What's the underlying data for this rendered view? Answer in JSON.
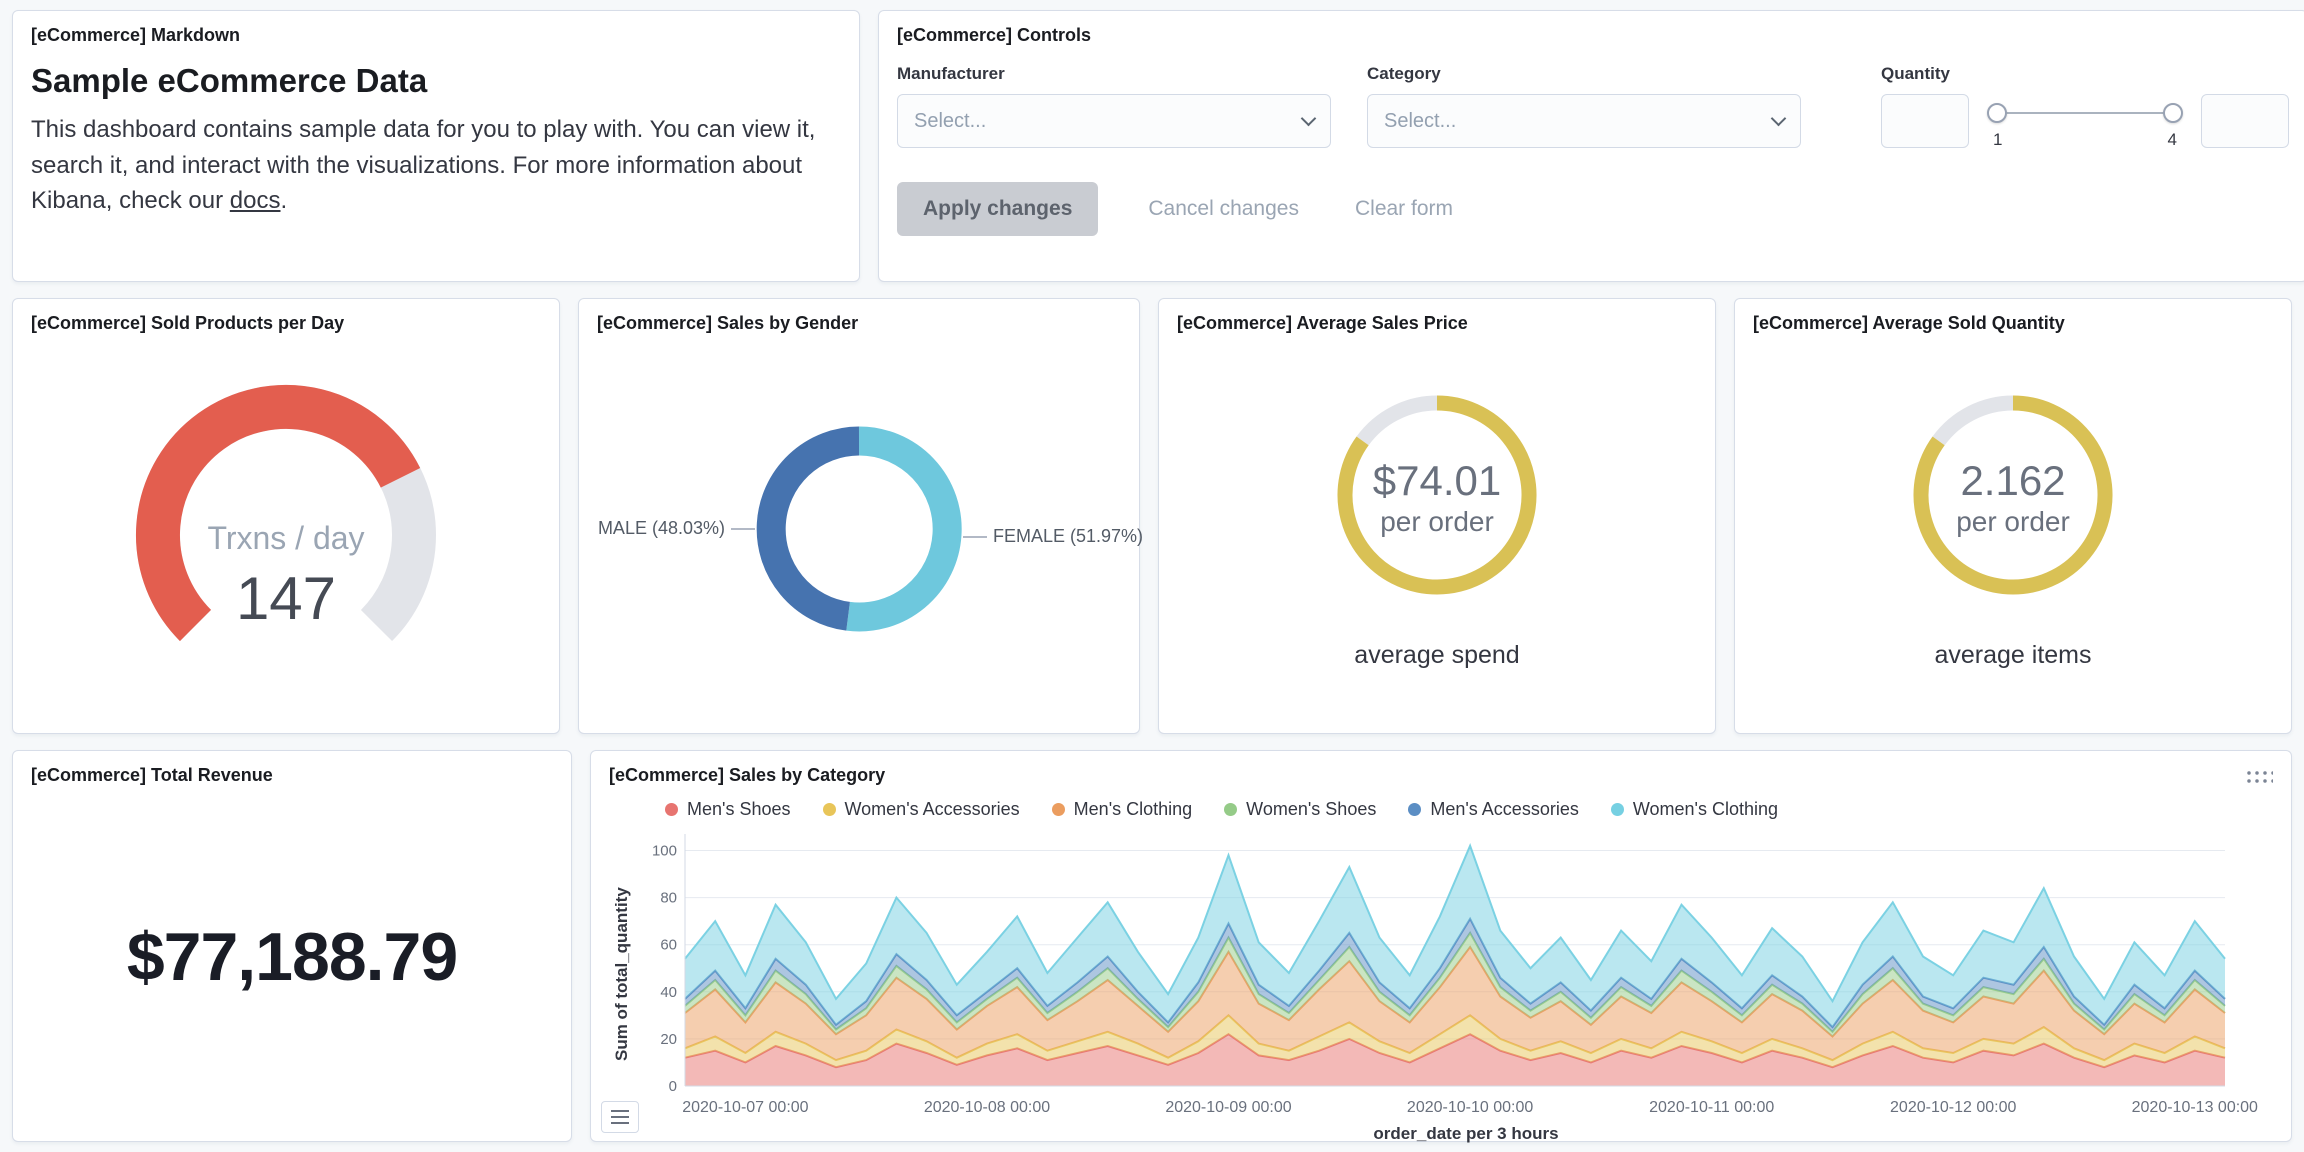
{
  "markdown_panel": {
    "title": "[eCommerce] Markdown",
    "heading": "Sample eCommerce Data",
    "body_1": "This dashboard contains sample data for you to play with. You can view it, search it, and interact with the visualizations. For more information about Kibana, check our ",
    "link_text": "docs",
    "body_2": "."
  },
  "controls_panel": {
    "title": "[eCommerce] Controls",
    "manufacturer_label": "Manufacturer",
    "manufacturer_placeholder": "Select...",
    "category_label": "Category",
    "category_placeholder": "Select...",
    "quantity_label": "Quantity",
    "quantity_min": "1",
    "quantity_max": "4",
    "apply_label": "Apply changes",
    "cancel_label": "Cancel changes",
    "clear_label": "Clear form"
  },
  "gauge_panel": {
    "title": "[eCommerce] Sold Products per Day",
    "label": "Trxns / day",
    "value": "147",
    "fraction": 0.735,
    "color": "#e35e4f",
    "track_color": "#e2e4e9"
  },
  "gender_panel": {
    "title": "[eCommerce] Sales by Gender",
    "male_label": "MALE (48.03%)",
    "female_label": "FEMALE (51.97%)",
    "male_fraction": 0.4803,
    "female_fraction": 0.5197,
    "male_color": "#4673af",
    "female_color": "#6ec8dd"
  },
  "avg_price_panel": {
    "title": "[eCommerce] Average Sales Price",
    "value": "$74.01",
    "unit": "per order",
    "caption": "average spend",
    "fraction": 0.85,
    "color": "#d9c155",
    "track_color": "#e2e4e9"
  },
  "avg_qty_panel": {
    "title": "[eCommerce] Average Sold Quantity",
    "value": "2.162",
    "unit": "per order",
    "caption": "average items",
    "fraction": 0.85,
    "color": "#d9c155",
    "track_color": "#e2e4e9"
  },
  "revenue_panel": {
    "title": "[eCommerce] Total Revenue",
    "value": "$77,188.79"
  },
  "category_panel": {
    "title": "[eCommerce] Sales by Category"
  },
  "chart_data": {
    "type": "area",
    "stacked": true,
    "title": "[eCommerce] Sales by Category",
    "xlabel": "order_date per 3 hours",
    "ylabel": "Sum of total_quantity",
    "ylim": [
      0,
      100
    ],
    "yticks": [
      0,
      20,
      40,
      60,
      80,
      100
    ],
    "legend_position": "top",
    "num_points": 52,
    "x_tick_positions": [
      2,
      10,
      18,
      26,
      34,
      42,
      50
    ],
    "x_tick_labels": [
      "2020-10-07 00:00",
      "2020-10-08 00:00",
      "2020-10-09 00:00",
      "2020-10-10 00:00",
      "2020-10-11 00:00",
      "2020-10-12 00:00",
      "2020-10-13 00:00"
    ],
    "series": [
      {
        "name": "Men's Shoes",
        "color": "#e77470",
        "values": [
          12,
          15,
          10,
          17,
          13,
          8,
          11,
          18,
          14,
          9,
          13,
          16,
          11,
          14,
          17,
          13,
          9,
          14,
          22,
          13,
          11,
          15,
          20,
          14,
          10,
          16,
          22,
          15,
          11,
          14,
          10,
          15,
          12,
          17,
          14,
          10,
          15,
          12,
          8,
          13,
          17,
          12,
          10,
          15,
          13,
          18,
          12,
          8,
          13,
          10,
          15,
          12
        ]
      },
      {
        "name": "Women's Accessories",
        "color": "#e8c559",
        "values": [
          4,
          6,
          4,
          6,
          5,
          3,
          4,
          6,
          5,
          3,
          5,
          6,
          4,
          5,
          6,
          5,
          3,
          5,
          8,
          5,
          4,
          6,
          7,
          5,
          4,
          6,
          8,
          5,
          4,
          5,
          4,
          5,
          4,
          6,
          5,
          4,
          5,
          4,
          3,
          5,
          6,
          4,
          4,
          5,
          5,
          7,
          4,
          3,
          5,
          4,
          6,
          4
        ]
      },
      {
        "name": "Men's Clothing",
        "color": "#eb9d5f",
        "values": [
          15,
          20,
          13,
          21,
          17,
          11,
          15,
          22,
          18,
          12,
          16,
          20,
          13,
          17,
          22,
          16,
          11,
          17,
          27,
          17,
          13,
          20,
          26,
          17,
          13,
          20,
          29,
          18,
          14,
          17,
          12,
          18,
          15,
          21,
          17,
          13,
          19,
          16,
          10,
          17,
          22,
          16,
          13,
          18,
          17,
          24,
          16,
          11,
          17,
          13,
          20,
          15
        ]
      },
      {
        "name": "Women's Shoes",
        "color": "#95cb88",
        "values": [
          3,
          4,
          3,
          5,
          4,
          2,
          3,
          5,
          4,
          3,
          3,
          4,
          3,
          4,
          5,
          3,
          2,
          4,
          6,
          4,
          3,
          4,
          6,
          4,
          3,
          4,
          6,
          4,
          3,
          4,
          3,
          4,
          3,
          5,
          4,
          3,
          4,
          3,
          2,
          4,
          5,
          3,
          3,
          4,
          4,
          5,
          3,
          2,
          4,
          3,
          4,
          3
        ]
      },
      {
        "name": "Men's Accessories",
        "color": "#5b8ec4",
        "values": [
          3,
          4,
          3,
          5,
          4,
          2,
          3,
          5,
          4,
          3,
          3,
          4,
          3,
          4,
          5,
          3,
          2,
          4,
          6,
          4,
          3,
          4,
          6,
          4,
          3,
          4,
          6,
          4,
          3,
          4,
          3,
          4,
          3,
          5,
          4,
          3,
          4,
          3,
          2,
          4,
          5,
          3,
          3,
          4,
          4,
          5,
          3,
          2,
          4,
          3,
          4,
          3
        ]
      },
      {
        "name": "Women's Clothing",
        "color": "#76d0e2",
        "values": [
          17,
          21,
          14,
          23,
          18,
          11,
          16,
          24,
          20,
          13,
          17,
          22,
          14,
          19,
          23,
          17,
          12,
          19,
          29,
          18,
          14,
          21,
          28,
          19,
          14,
          22,
          31,
          20,
          15,
          19,
          13,
          20,
          16,
          23,
          19,
          14,
          20,
          17,
          11,
          18,
          23,
          17,
          14,
          20,
          18,
          25,
          17,
          11,
          18,
          14,
          21,
          17
        ]
      }
    ]
  }
}
